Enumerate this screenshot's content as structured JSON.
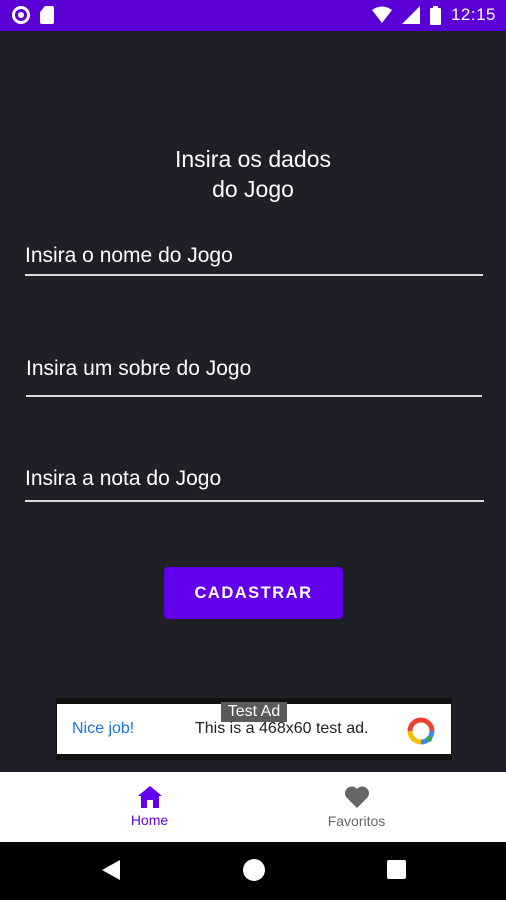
{
  "status_bar": {
    "time": "12:15",
    "background": "#5a00d6",
    "left_icons": [
      "sync-circle-icon",
      "sd-card-icon"
    ],
    "right_icons": [
      "wifi-icon",
      "signal-icon",
      "battery-icon"
    ]
  },
  "form": {
    "title_line1": "Insira os dados",
    "title_line2": "do Jogo",
    "fields": [
      {
        "label": "Insira o nome do Jogo"
      },
      {
        "label": "Insira um sobre do Jogo"
      },
      {
        "label": "Insira a nota do Jogo"
      }
    ],
    "submit_label": "CADASTRAR",
    "accent": "#6200ee"
  },
  "ad": {
    "badge": "Test Ad",
    "headline": "Nice job!",
    "body": "This is a 468x60 test ad."
  },
  "bottom_nav": {
    "items": [
      {
        "label": "Home",
        "icon": "home-icon",
        "active": true
      },
      {
        "label": "Favoritos",
        "icon": "heart-icon",
        "active": false
      }
    ]
  },
  "system_nav": {
    "icons": [
      "back-icon",
      "home-circle-icon",
      "recents-icon"
    ]
  }
}
